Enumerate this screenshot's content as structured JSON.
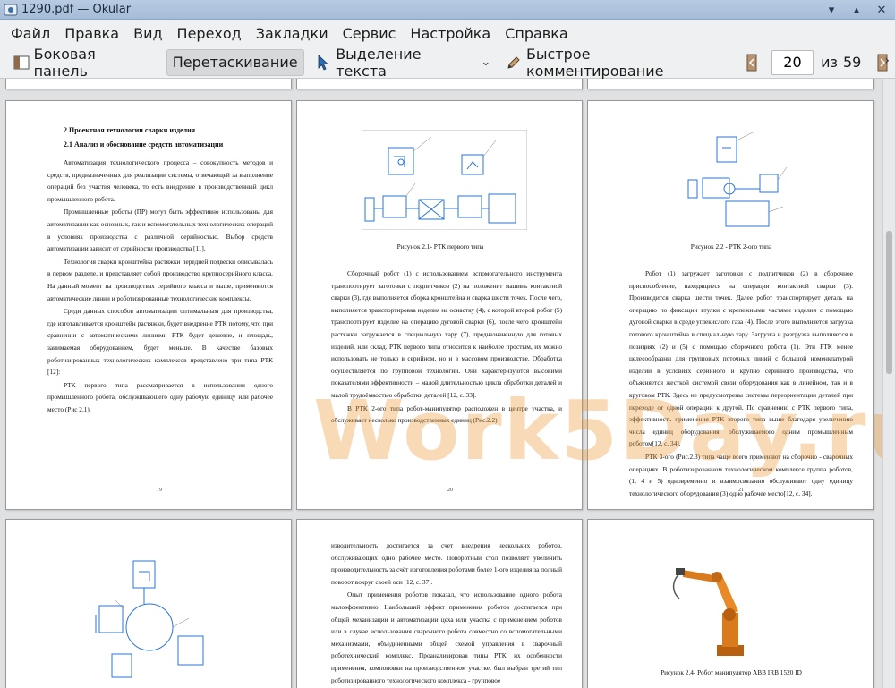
{
  "window": {
    "title": "1290.pdf — Okular"
  },
  "menu": [
    "Файл",
    "Правка",
    "Вид",
    "Переход",
    "Закладки",
    "Сервис",
    "Настройка",
    "Справка"
  ],
  "toolbar": {
    "sidebar_label": "Боковая панель",
    "drag_label": "Перетаскивание",
    "select_text_label": "Выделение текста",
    "quick_comment_label": "Быстрое комментирование",
    "current_page": "20",
    "of_label": "из",
    "total_pages": "59"
  },
  "pages": {
    "p19": {
      "heading1": "2 Проектная технологии сварки изделия",
      "heading2": "2.1 Анализ и обоснование средств автоматизации",
      "paragraphs": [
        "Автоматизация технологического процесса – совокупность методов и средств, предназначенных для реализации системы, отвечающей за выполнение операций без участия человека, то есть внедрение в производственный цикл промышленного робота.",
        "Промышленные роботы (ПР) могут быть эффективно использованы для автоматизации как основных, так и вспомогательных технологических операций в условиях производства с различной серийностью. Выбор средств автоматизации зависит от серийности производства [11].",
        "Технология сварки кронштейна растяжки передней подвески описывалась в первом разделе, и представляет собой производство крупносерийного класса. На данный момент на производствах серийного класса и выше, применяются автоматические линии и роботизированные технологические комплексы.",
        "Среди данных способов автоматизации оптимальным для производства, где изготавливается кронштейн растяжки, будет внедрение РТК потому, что при сравнении с автоматическими линиями РТК будет дешевле, и площадь, занимаемая оборудованием, будет меньше. В качестве базовых роботизированных технологических комплексов представлено три типа РТК [12]:",
        "РТК первого типа рассматривается в использовании одного промышленного робота, обслуживающего одну рабочую единицу или рабочее место (Рис 2.1)."
      ],
      "page_number": "19"
    },
    "p20": {
      "caption": "Рисунок 2.1- РТК первого типа",
      "paragraphs": [
        "Сборочный робот (1) с использованием вспомогательного инструмента транспортирует заготовки с подпитчиков (2) на положенит машинь контактной сварки (3), где выполняется сборка кронштейна и сварка шести точек. После чего, выполняется транспортировка изделия на оснастку (4), с которой второй робот (5) транспортирует изделие на операцию дуговой сварки (6), после чего кронштейн растяжки загружается в специальную тару (7), предназначенную для готовых изделий, или склад. РТК первого типа относится к наиболее простым, их можно использовать не только в серийном, но и в массовом производстве. Обработка осуществляется по групповой технологии. Они характеризуются высокими показателями эффективности – малой длительностью цикла обработки деталей и малой трудоёмкостью обработки деталей [12, с. 33].",
        "В РТК 2-ого типа робот-манипулятор расположен в центре участка, и обслуживает несколько производственных единиц (Рис.2.2)"
      ],
      "page_number": "20"
    },
    "p21": {
      "caption": "Рисунок 2.2 - РТК 2-ого типа",
      "paragraphs": [
        "Робот (1) загружает заготовки с подпитчиков (2) в сборочное приспособление, находящиеся на операции контактной сварки (3). Производится сварка шести точек. Далее робот транспортирует деталь на операцию по фиксации втулки с крепежными частями изделия с помощью дуговой сварки в среде углекислого газа (4). После этого выполняется загрузка готового кронштейна в специальную тару. Загрузка и разгрузка выполняется в позициях (2) и (5) с помощью сборочного робота (1). Эти РТК менее целесообразны для групповых поточных линий с большой номенклатурой изделий в условиях серийного и крупно серийного производства, что объясняется жесткой системой связи оборудования как в линейном, так и в круговом РТК. Здесь не предусмотрены системы переориентации деталей при переходе от одной операции к другой. По сравнению с РТК первого типа, эффективность применения РТК второго типа выше благодаря увеличению числа единиц оборудования, обслуживаемого одним промышленным роботом[12, с. 34].",
        "РТК 3-ого (Рис.2.3) типа чаще всего применяют на сборочно - сварочных операциях. В роботизированном технологическом комплексе группа роботов, (1, 4 и 5) одновременно и взаимосвязанно обслуживают одну единицу технологического оборудования (3) одно рабочее место[12, с. 34]."
      ],
      "page_number": "21"
    },
    "p23": {
      "paragraphs": [
        "изводительность достигается за счет внедрения нескольких роботов, обслуживающих одно рабочее место. Поворотный стол позволяет увеличить производительность за счёт изготовления роботами более 1-ого изделия за полный поворот вокруг своей оси [12, с. 37].",
        "Опыт применения роботов показал, что использование одного робота малоэффективно. Наибольший эффект применения роботов достигается при общей механизации и автоматизации цеха или участка с применением роботов или в случае использования сварочного робота совместно со вспомогательными механизмами, объединенными общей схемой управления в сварочный роботехнический комплекс. Проанализировав типы РТК, их особенности применения, компоновки на производственном участке, был выбран третий тип роботизированного технологического комплекса - групповое"
      ]
    },
    "p24": {
      "caption": "Рисунок 2.4- Робот манипулятор ABB IRB 1520 ID"
    }
  },
  "watermark": "Work5Day.ru"
}
